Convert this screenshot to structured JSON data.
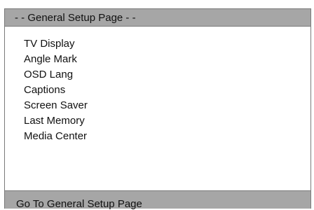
{
  "header": {
    "title": "- - General Setup Page - -"
  },
  "menu": {
    "items": [
      {
        "label": "TV Display"
      },
      {
        "label": "Angle Mark"
      },
      {
        "label": "OSD Lang"
      },
      {
        "label": "Captions"
      },
      {
        "label": "Screen Saver"
      },
      {
        "label": "Last Memory"
      },
      {
        "label": "Media Center"
      }
    ]
  },
  "status": {
    "text": "Go To General Setup Page"
  },
  "colors": {
    "bar_background": "#a6a6a6",
    "panel_background": "#ffffff",
    "text": "#111111",
    "border": "#7a7a7a"
  }
}
